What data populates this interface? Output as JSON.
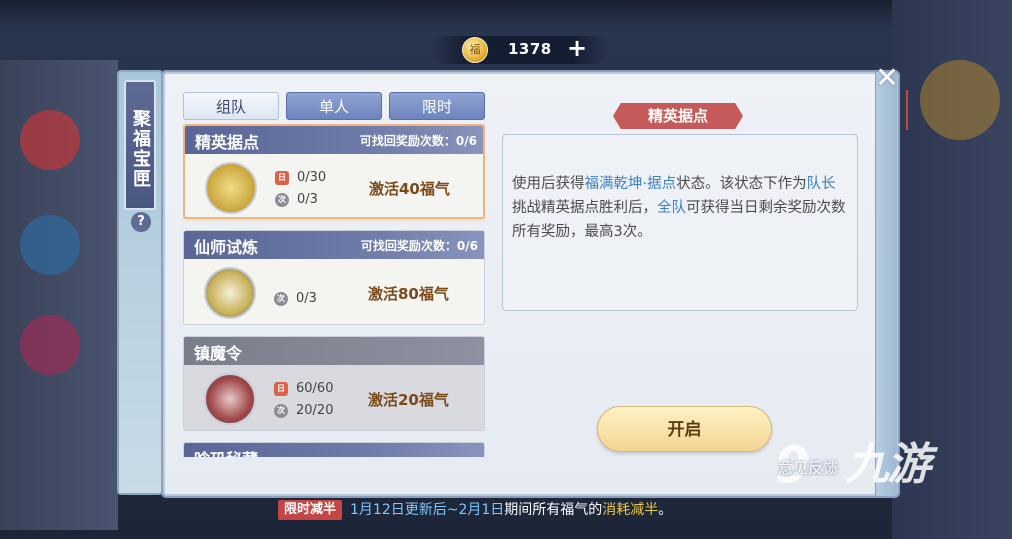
{
  "currency": {
    "icon": "coin-icon",
    "value": "1378",
    "coin_char": "福"
  },
  "side_tab": {
    "title": "聚福宝匣",
    "help": "?"
  },
  "tabs": [
    {
      "label": "组队",
      "active": true
    },
    {
      "label": "单人",
      "active": false
    },
    {
      "label": "限时",
      "active": false
    }
  ],
  "cards": [
    {
      "name": "精英据点",
      "claim_label": "可找回奖励次数：",
      "claim_value": "0/6",
      "daily": "0/30",
      "count": "0/3",
      "reward": "激活40福气",
      "selected": true,
      "locked": false,
      "has_daily": true
    },
    {
      "name": "仙师试炼",
      "claim_label": "可找回奖励次数：",
      "claim_value": "0/6",
      "daily": "",
      "count": "0/3",
      "reward": "激活80福气",
      "selected": false,
      "locked": false,
      "has_daily": false
    },
    {
      "name": "镇魔令",
      "claim_label": "",
      "claim_value": "",
      "daily": "60/60",
      "count": "20/20",
      "reward": "激活20福气",
      "selected": false,
      "locked": true,
      "has_daily": true
    },
    {
      "name": "晗玑秘藏",
      "claim_label": "",
      "claim_value": "",
      "daily": "",
      "count": "",
      "reward": "",
      "selected": false,
      "locked": false,
      "has_daily": false
    }
  ],
  "stat_icons": {
    "daily": "日",
    "count": "次"
  },
  "detail": {
    "title": "精英据点",
    "text_parts": [
      {
        "t": "使用后获得",
        "hl": false
      },
      {
        "t": "福满乾坤·据点",
        "hl": true
      },
      {
        "t": "状态。该状态下作为",
        "hl": false
      },
      {
        "t": "队长",
        "hl": true
      },
      {
        "t": "挑战精英据点胜利后，",
        "hl": false
      },
      {
        "t": "全队",
        "hl": true
      },
      {
        "t": "可获得当日剩余奖励次数所有奖励，最高3次。",
        "hl": false
      }
    ]
  },
  "start_button": "开启",
  "feedback": "意见反馈",
  "watermark": {
    "mark": "9",
    "text": "九游"
  },
  "notice": {
    "badge": "限时减半",
    "parts": [
      {
        "t": "1月12日更新后~2月1日",
        "c": "date"
      },
      {
        "t": "期间所有福气的",
        "c": ""
      },
      {
        "t": "消耗减半",
        "c": "hot"
      },
      {
        "t": "。",
        "c": ""
      }
    ]
  },
  "colors": {
    "accent": "#5a6696",
    "highlight": "#3e7fc0",
    "badge": "#c44545",
    "selected_border": "#f2b47a"
  }
}
